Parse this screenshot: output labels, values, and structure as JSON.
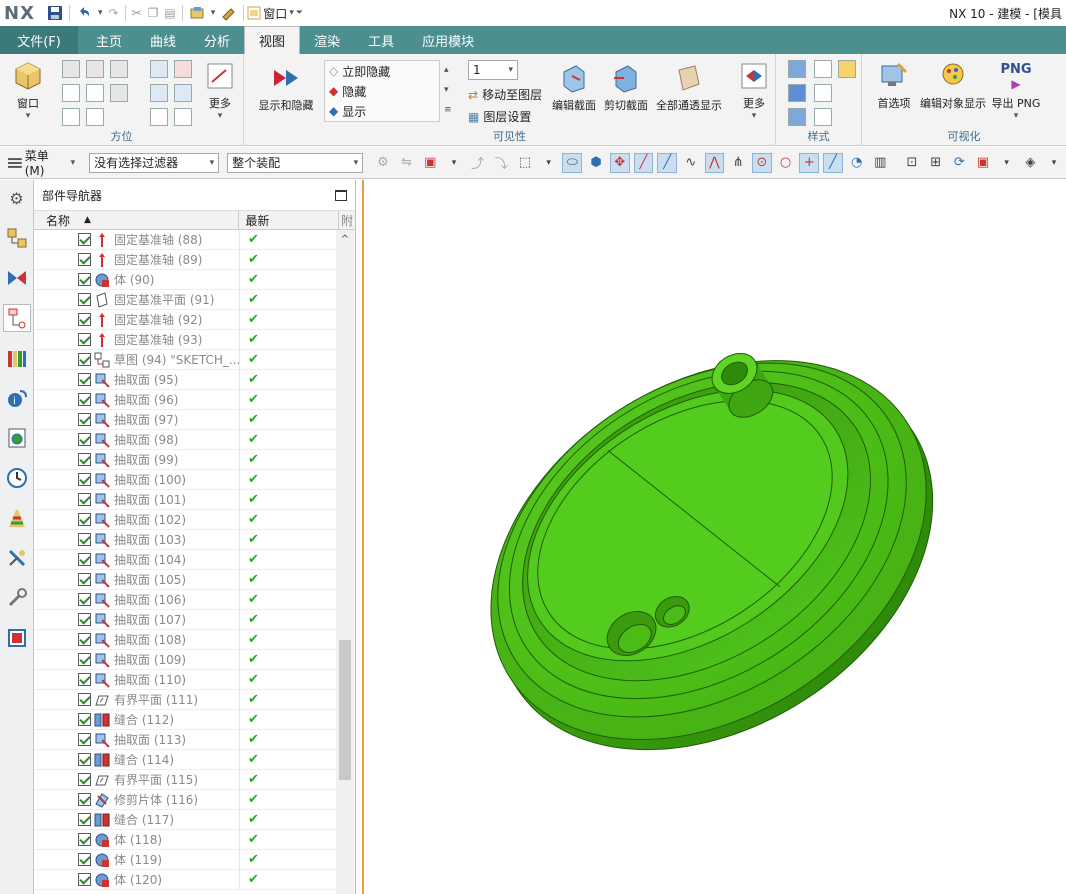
{
  "titlebar": {
    "logo": "NX",
    "window_menu_label": "窗口",
    "title": "NX 10 - 建模 - [模具"
  },
  "menu_tabs": {
    "file": "文件(F)",
    "tabs": [
      "主页",
      "曲线",
      "分析",
      "视图",
      "渲染",
      "工具",
      "应用模块"
    ],
    "active": "视图"
  },
  "ribbon": {
    "orientation_group": {
      "window_label": "窗口",
      "more_label": "更多",
      "group_label": "方位"
    },
    "visibility_group": {
      "show_hide_label": "显示和隐藏",
      "instant_hide": "立即隐藏",
      "hide": "隐藏",
      "show": "显示",
      "layer_value": "1",
      "move_to_layer": "移动至图层",
      "layer_settings": "图层设置",
      "group_label": "可见性"
    },
    "section_group": {
      "edit_section": "编辑截面",
      "clip_section": "剪切截面",
      "all_transparent": "全部通透显示",
      "more_label": "更多"
    },
    "style_group": {
      "group_label": "样式"
    },
    "visualization_group": {
      "preferences": "首选项",
      "edit_object_display": "编辑对象显示",
      "export_png": "导出 PNG",
      "png_badge": "PNG",
      "group_label": "可视化"
    }
  },
  "toolbar": {
    "menu_label": "菜单(M)",
    "filter_value": "没有选择过滤器",
    "scope_value": "整个装配"
  },
  "navigator": {
    "title": "部件导航器",
    "col_name": "名称",
    "col_latest": "最新",
    "col_extra": "附",
    "items": [
      {
        "label": "固定基准轴 (88)",
        "icon": "datum-axis-icon"
      },
      {
        "label": "固定基准轴 (89)",
        "icon": "datum-axis-icon"
      },
      {
        "label": "体 (90)",
        "icon": "body-icon"
      },
      {
        "label": "固定基准平面 (91)",
        "icon": "datum-plane-icon"
      },
      {
        "label": "固定基准轴 (92)",
        "icon": "datum-axis-icon"
      },
      {
        "label": "固定基准轴 (93)",
        "icon": "datum-axis-icon"
      },
      {
        "label": "草图 (94) \"SKETCH_...",
        "icon": "sketch-icon"
      },
      {
        "label": "抽取面 (95)",
        "icon": "extract-face-icon"
      },
      {
        "label": "抽取面 (96)",
        "icon": "extract-face-icon"
      },
      {
        "label": "抽取面 (97)",
        "icon": "extract-face-icon"
      },
      {
        "label": "抽取面 (98)",
        "icon": "extract-face-icon"
      },
      {
        "label": "抽取面 (99)",
        "icon": "extract-face-icon"
      },
      {
        "label": "抽取面 (100)",
        "icon": "extract-face-icon"
      },
      {
        "label": "抽取面 (101)",
        "icon": "extract-face-icon"
      },
      {
        "label": "抽取面 (102)",
        "icon": "extract-face-icon"
      },
      {
        "label": "抽取面 (103)",
        "icon": "extract-face-icon"
      },
      {
        "label": "抽取面 (104)",
        "icon": "extract-face-icon"
      },
      {
        "label": "抽取面 (105)",
        "icon": "extract-face-icon"
      },
      {
        "label": "抽取面 (106)",
        "icon": "extract-face-icon"
      },
      {
        "label": "抽取面 (107)",
        "icon": "extract-face-icon"
      },
      {
        "label": "抽取面 (108)",
        "icon": "extract-face-icon"
      },
      {
        "label": "抽取面 (109)",
        "icon": "extract-face-icon"
      },
      {
        "label": "抽取面 (110)",
        "icon": "extract-face-icon"
      },
      {
        "label": "有界平面 (111)",
        "icon": "bounded-plane-icon"
      },
      {
        "label": "缝合 (112)",
        "icon": "sew-icon"
      },
      {
        "label": "抽取面 (113)",
        "icon": "extract-face-icon"
      },
      {
        "label": "缝合 (114)",
        "icon": "sew-icon"
      },
      {
        "label": "有界平面 (115)",
        "icon": "bounded-plane-icon"
      },
      {
        "label": "修剪片体 (116)",
        "icon": "trim-sheet-icon"
      },
      {
        "label": "缝合 (117)",
        "icon": "sew-icon"
      },
      {
        "label": "体 (118)",
        "icon": "body-icon"
      },
      {
        "label": "体 (119)",
        "icon": "body-icon"
      },
      {
        "label": "体 (120)",
        "icon": "body-icon"
      }
    ]
  },
  "colors": {
    "model_green": "#4fc21a",
    "tab_bar": "#4d8f8f",
    "graphics_border": "#e59c4a",
    "tick_green": "#2aa82a"
  }
}
